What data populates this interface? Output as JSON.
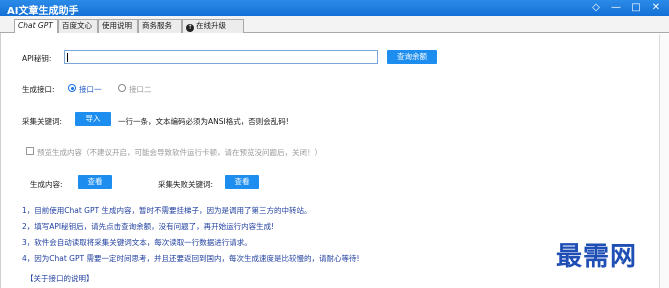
{
  "window": {
    "title": "AI文章生成助手",
    "buttons": [
      "◇",
      "—",
      "□",
      "✕"
    ]
  },
  "tabs": [
    {
      "label": "Chat GPT",
      "active": true
    },
    {
      "label": "百度文心"
    },
    {
      "label": "使用说明"
    },
    {
      "label": "商务服务"
    },
    {
      "label": "在线升级",
      "icon": "arrow-up-icon"
    }
  ],
  "api": {
    "label": "API秘钥:",
    "value": "",
    "query_button": "查询余额"
  },
  "interface": {
    "label": "生成接口:",
    "option1": "接口一",
    "option2": "接口二",
    "selected": "接口一"
  },
  "keywords": {
    "label": "采集关键词:",
    "import_button": "导入",
    "hint": "一行一条，文本编码必须为ANSI格式，否则会乱码!"
  },
  "preview": {
    "label": "预览生成内容（不建议开启，可能会导致软件运行卡顿，请在预览没问题后，关闭！）",
    "checked": false
  },
  "view": {
    "content_label": "生成内容:",
    "content_button": "查看",
    "failed_label": "采集失败关键词:",
    "failed_button": "查看"
  },
  "notes": [
    "1，目前使用Chat GPT 生成内容，暂时不需要挂梯子，因为是调用了第三方的中转站。",
    "2，填写API秘钥后，请先点击查询余额，没有问题了，再开始运行内容生成!",
    "3，软件会自动读取将采集关键词文本，每次读取一行数据进行请求。",
    "4，因为Chat GPT 需要一定时间思考，并且还要返回到国内，每次生成速度是比较慢的，请耐心等待!"
  ],
  "about_link": "【关于接口的说明】",
  "watermark": "最需网"
}
